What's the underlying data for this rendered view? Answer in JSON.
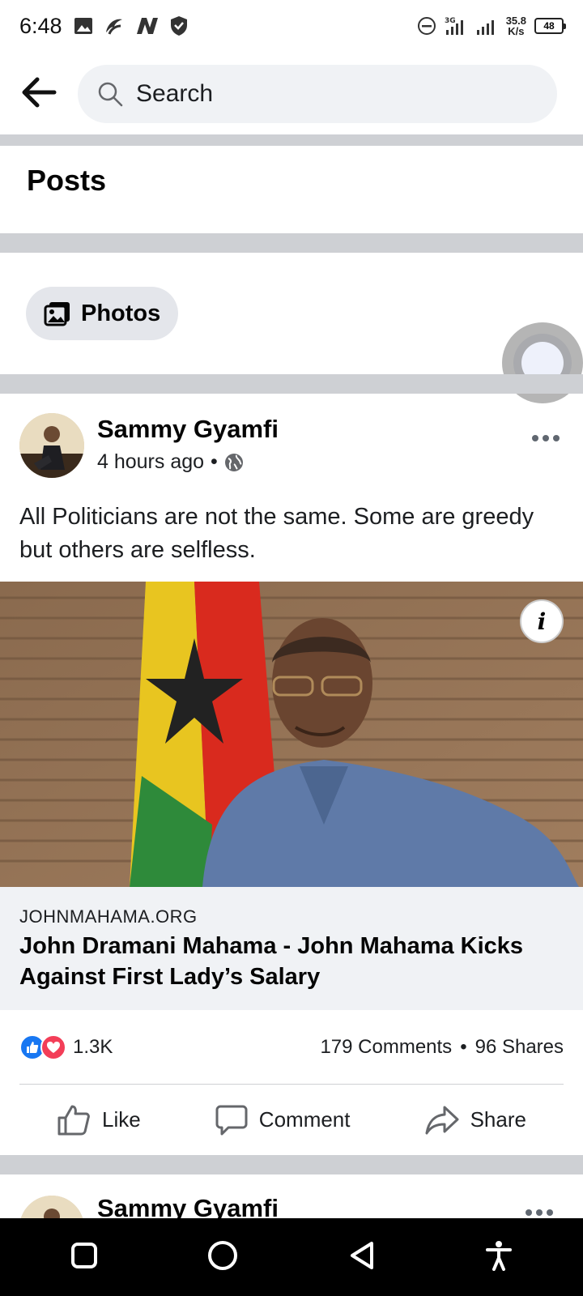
{
  "status_bar": {
    "time": "6:48",
    "network_speed_value": "35.8",
    "network_speed_unit": "K/s",
    "battery": "48",
    "left_icons": [
      "gallery-icon",
      "vpn-icon",
      "n-app-icon",
      "shield-icon"
    ],
    "right_icons": [
      "dnd-icon",
      "signal-3g-icon",
      "signal-icon",
      "battery-icon"
    ]
  },
  "header": {
    "search_placeholder": "Search"
  },
  "section": {
    "title": "Posts"
  },
  "filters": {
    "photos_label": "Photos"
  },
  "post": {
    "author": "Sammy Gyamfi",
    "time": "4 hours ago",
    "separator": "•",
    "text": "All Politicians are not the same. Some are greedy but others are selfless.",
    "link": {
      "domain": "JOHNMAHAMA.ORG",
      "title": "John Dramani Mahama - John Mahama Kicks Against First Lady’s Salary"
    },
    "reactions_count": "1.3K",
    "comments": "179 Comments",
    "stats_separator": "•",
    "shares": "96 Shares",
    "actions": {
      "like": "Like",
      "comment": "Comment",
      "share": "Share"
    }
  },
  "next_post": {
    "author": "Sammy Gyamfi"
  },
  "colors": {
    "accent": "#1877f2",
    "love": "#f33e58",
    "divider": "#ced0d4"
  }
}
